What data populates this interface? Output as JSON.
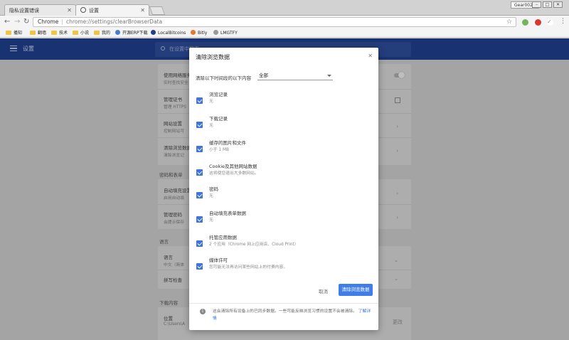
{
  "tabs": [
    {
      "title": "隐私设置错误"
    },
    {
      "title": "设置"
    }
  ],
  "window": {
    "profile": "Gear0023"
  },
  "toolbar": {
    "chip": "Chrome",
    "url": "chrome://settings/clearBrowserData"
  },
  "bookmarks": [
    "播知",
    "翻墙",
    "技术",
    "小说",
    "我的",
    "开源ERP下载",
    "LocalBitcoins",
    "Bitly",
    "LMGTFY"
  ],
  "settings": {
    "title": "设置",
    "search_placeholder": "在设置中搜索",
    "rows": [
      {
        "label": "使用网络服务",
        "sub": "实时查找安全"
      },
      {
        "label": "管理证书",
        "sub": "管理 HTTPS"
      },
      {
        "label": "网站设置",
        "sub": "控制网站可"
      },
      {
        "label": "清除浏览数据",
        "sub": "清除浏览记"
      }
    ],
    "section_passwords": "密码和表单",
    "rows2": [
      {
        "label": "自动填充设置",
        "sub": "启用自动填"
      },
      {
        "label": "管理密码",
        "sub": "会提示保存"
      }
    ],
    "section_language": "语言",
    "rows3": [
      {
        "label": "语言",
        "sub": "中文（简体"
      },
      {
        "label": "拼写检查",
        "sub": ""
      }
    ],
    "section_downloads": "下载内容",
    "rows4": [
      {
        "label": "位置",
        "sub": "C:\\Users\\A",
        "action": "更改"
      }
    ]
  },
  "dialog": {
    "title": "清除浏览数据",
    "range_label": "清除以下时间段的以下内容",
    "range_value": "全部",
    "options": [
      {
        "label": "浏览记录",
        "sub": "无"
      },
      {
        "label": "下载记录",
        "sub": "无"
      },
      {
        "label": "缓存的图片和文件",
        "sub": "小于 1 MB"
      },
      {
        "label": "Cookie及其他网站数据",
        "sub": "这将使您退出大多数网站。"
      },
      {
        "label": "密码",
        "sub": "无"
      },
      {
        "label": "自动填充表单数据",
        "sub": "无"
      },
      {
        "label": "托管应用数据",
        "sub": "2 个应用（Chrome 网上应用店、Cloud Print）"
      },
      {
        "label": "媒体许可",
        "sub": "您可能无法再访问某些网站上的付费内容。"
      }
    ],
    "cancel": "取消",
    "clear": "清除浏览数据",
    "footer_text": "这会清除所有设备上的已同步数据。一些可能反映浏览习惯的设置不会被清除。",
    "footer_link": "了解详情"
  },
  "colors": {
    "accent": "#3f74d9",
    "header": "#1f3e8a"
  }
}
